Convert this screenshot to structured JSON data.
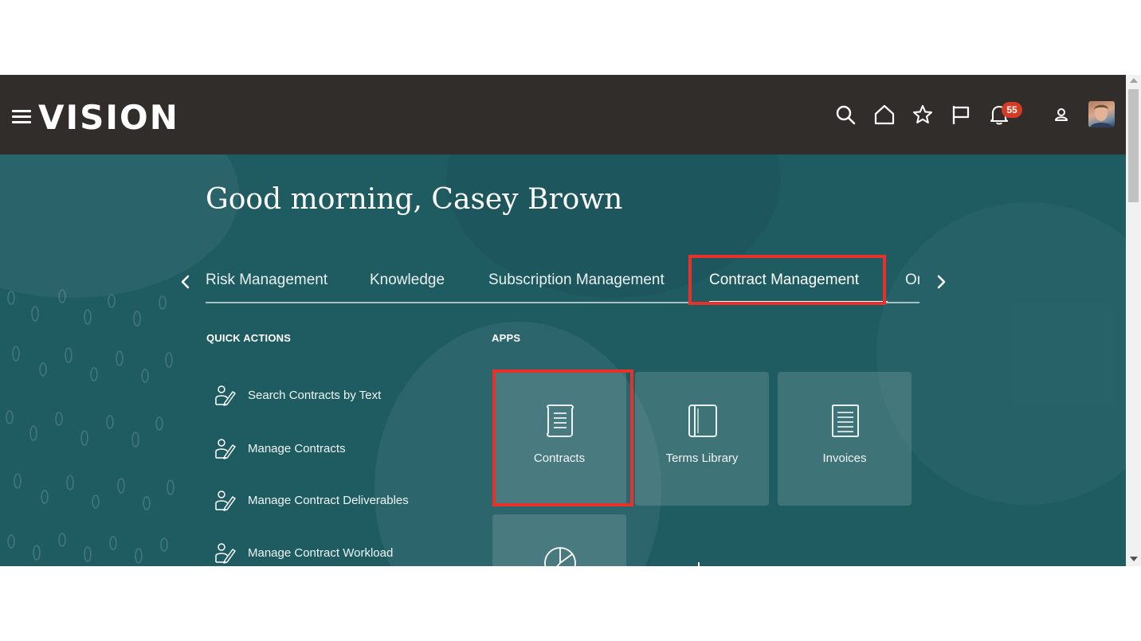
{
  "topbar": {
    "logo": "VISION",
    "notifications_count": "55"
  },
  "hero": {
    "greeting": "Good morning, Casey Brown"
  },
  "tabs": [
    {
      "label": "Risk Management"
    },
    {
      "label": "Knowledge"
    },
    {
      "label": "Subscription Management"
    },
    {
      "label": "Contract Management"
    },
    {
      "label": "Or"
    }
  ],
  "quick_actions": {
    "heading": "QUICK ACTIONS",
    "items": [
      {
        "label": "Search Contracts by Text"
      },
      {
        "label": "Manage Contracts"
      },
      {
        "label": "Manage Contract Deliverables"
      },
      {
        "label": "Manage Contract Workload"
      }
    ]
  },
  "apps": {
    "heading": "APPS",
    "items": [
      {
        "label": "Contracts",
        "icon": "scroll-document-icon"
      },
      {
        "label": "Terms Library",
        "icon": "book-icon"
      },
      {
        "label": "Invoices",
        "icon": "invoice-icon"
      },
      {
        "label": "",
        "icon": "pie-chart-icon"
      }
    ]
  },
  "colors": {
    "topbar": "#312d2a",
    "hero_bg": "#1f5c62",
    "highlight": "#e8312a",
    "badge": "#d63b25",
    "chat_button": "#d73d28"
  }
}
